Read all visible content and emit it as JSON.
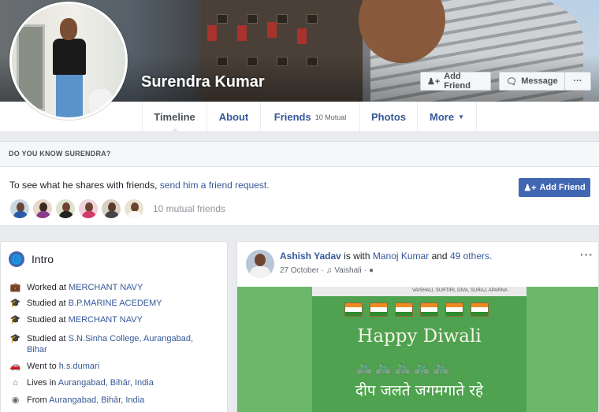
{
  "profile": {
    "name": "Surendra Kumar"
  },
  "cover_actions": {
    "add_friend": "Add Friend",
    "message": "Message",
    "more": "···"
  },
  "nav": {
    "tabs": [
      {
        "label": "Timeline"
      },
      {
        "label": "About"
      },
      {
        "label": "Friends",
        "sub": "10 Mutual"
      },
      {
        "label": "Photos"
      },
      {
        "label": "More"
      }
    ]
  },
  "know": {
    "heading": "DO YOU KNOW SURENDRA?",
    "text_prefix": "To see what he shares with friends,",
    "text_link": "send him a friend request.",
    "button": "Add Friend",
    "mutual_count": "10 mutual friends"
  },
  "intro": {
    "title": "Intro",
    "rows": [
      {
        "icon": "briefcase-icon",
        "prefix": "Worked at",
        "link": "MERCHANT NAVY"
      },
      {
        "icon": "graduation-cap-icon",
        "prefix": "Studied at",
        "link": "B.P.MARINE ACEDEMY"
      },
      {
        "icon": "graduation-cap-icon",
        "prefix": "Studied at",
        "link": "MERCHANT NAVY"
      },
      {
        "icon": "graduation-cap-icon",
        "prefix": "Studied at",
        "link": "S.N.Sinha College, Aurangabad, Bihar"
      },
      {
        "icon": "car-icon",
        "prefix": "Went to",
        "link": "h.s.dumari"
      },
      {
        "icon": "home-icon",
        "prefix": "Lives in",
        "link": "Aurangabad, Bihār, India"
      },
      {
        "icon": "location-pin-icon",
        "prefix": "From",
        "link": "Aurangabad, Bihār, India"
      }
    ]
  },
  "post": {
    "author": "Ashish Yadav",
    "with_text": "is with",
    "tagged": "Manoj Kumar",
    "and_text": "and",
    "others": "49 others.",
    "date": "27 October",
    "location": "Vaishali",
    "image": {
      "top_tag": "VAISHALI, SURTIRI, DIVA, SURAJ, APARNA",
      "headline": "Happy Diwali",
      "hindi": "दीप जलते जगमगाते रहे"
    }
  },
  "colors": {
    "link": "#365899",
    "accent": "#4267b2",
    "background": "#e9ebee"
  }
}
